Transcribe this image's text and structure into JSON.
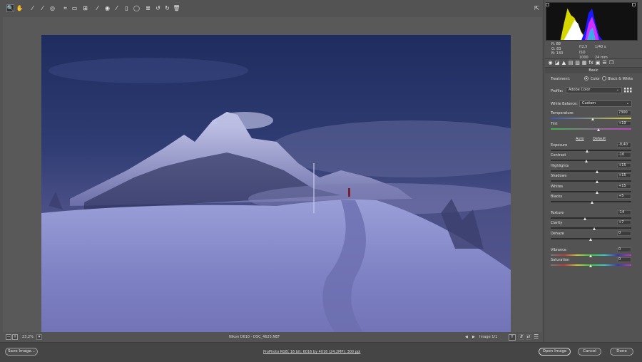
{
  "toolbar": {
    "tools": [
      {
        "icon": "zoom-icon",
        "active": true
      },
      {
        "icon": "hand-icon"
      },
      {
        "icon": "white-balance-icon"
      },
      {
        "icon": "color-sampler-icon"
      },
      {
        "icon": "targeted-adjustment-icon"
      },
      {
        "icon": "crop-icon"
      },
      {
        "icon": "straighten-icon"
      },
      {
        "icon": "transform-icon"
      },
      {
        "icon": "spot-removal-icon"
      },
      {
        "icon": "red-eye-icon"
      },
      {
        "icon": "adjustment-brush-icon"
      },
      {
        "icon": "graduated-filter-icon"
      },
      {
        "icon": "radial-filter-icon"
      },
      {
        "icon": "preferences-icon"
      },
      {
        "icon": "rotate-left-icon"
      },
      {
        "icon": "rotate-right-icon"
      },
      {
        "icon": "trash-icon"
      }
    ],
    "right_icon": "fullscreen-icon"
  },
  "status": {
    "zoom": "23,2%",
    "filename": "Nikon D610  -  DSC_4625.NEF",
    "image_count": "Image 1/1",
    "compare": "Y"
  },
  "info": {
    "r": "R:   88",
    "g": "G:   83",
    "b": "B:  130",
    "aperture": "f/2,5",
    "shutter": "1/40 s",
    "iso": "ISO 1000",
    "focal": "24 mm"
  },
  "panel": {
    "tab_icons": [
      "basic-icon",
      "tone-curve-icon",
      "detail-icon",
      "hsl-icon",
      "split-toning-icon",
      "lens-icon",
      "fx-icon",
      "calibration-icon",
      "presets-icon",
      "snapshots-icon"
    ],
    "section": "Basic",
    "treatment_label": "Treatment:",
    "treatment_color": "Color",
    "treatment_bw": "Black & White",
    "profile_label": "Profile:",
    "profile_value": "Adobe Color",
    "wb_label": "White Balance:",
    "wb_value": "Custom",
    "auto_label": "Auto",
    "default_label": "Default"
  },
  "sliders": [
    {
      "label": "Temperature",
      "value": "7300",
      "pos": 0.53,
      "kind": "temp"
    },
    {
      "label": "Tint",
      "value": "+19",
      "pos": 0.6,
      "kind": "tint"
    },
    {
      "label": "Exposure",
      "value": "-0,40",
      "pos": 0.46
    },
    {
      "label": "Contrast",
      "value": "-10",
      "pos": 0.45
    },
    {
      "label": "Highlights",
      "value": "+15",
      "pos": 0.58
    },
    {
      "label": "Shadows",
      "value": "+15",
      "pos": 0.58
    },
    {
      "label": "Whites",
      "value": "+15",
      "pos": 0.58
    },
    {
      "label": "Blacks",
      "value": "+5",
      "pos": 0.52
    },
    {
      "label": "Texture",
      "value": "-14",
      "pos": 0.43
    },
    {
      "label": "Clarity",
      "value": "+7",
      "pos": 0.54
    },
    {
      "label": "Dehaze",
      "value": "0",
      "pos": 0.5
    },
    {
      "label": "Vibrance",
      "value": "0",
      "pos": 0.5,
      "kind": "vib"
    },
    {
      "label": "Saturation",
      "value": "0",
      "pos": 0.5,
      "kind": "sat"
    }
  ],
  "bottom": {
    "save_label": "Save Image...",
    "workflow": "ProPhoto RGB; 16 bit; 6016 by 4016 (24,2MP); 300 ppi",
    "open_label": "Open Image",
    "cancel_label": "Cancel",
    "done_label": "Done"
  }
}
